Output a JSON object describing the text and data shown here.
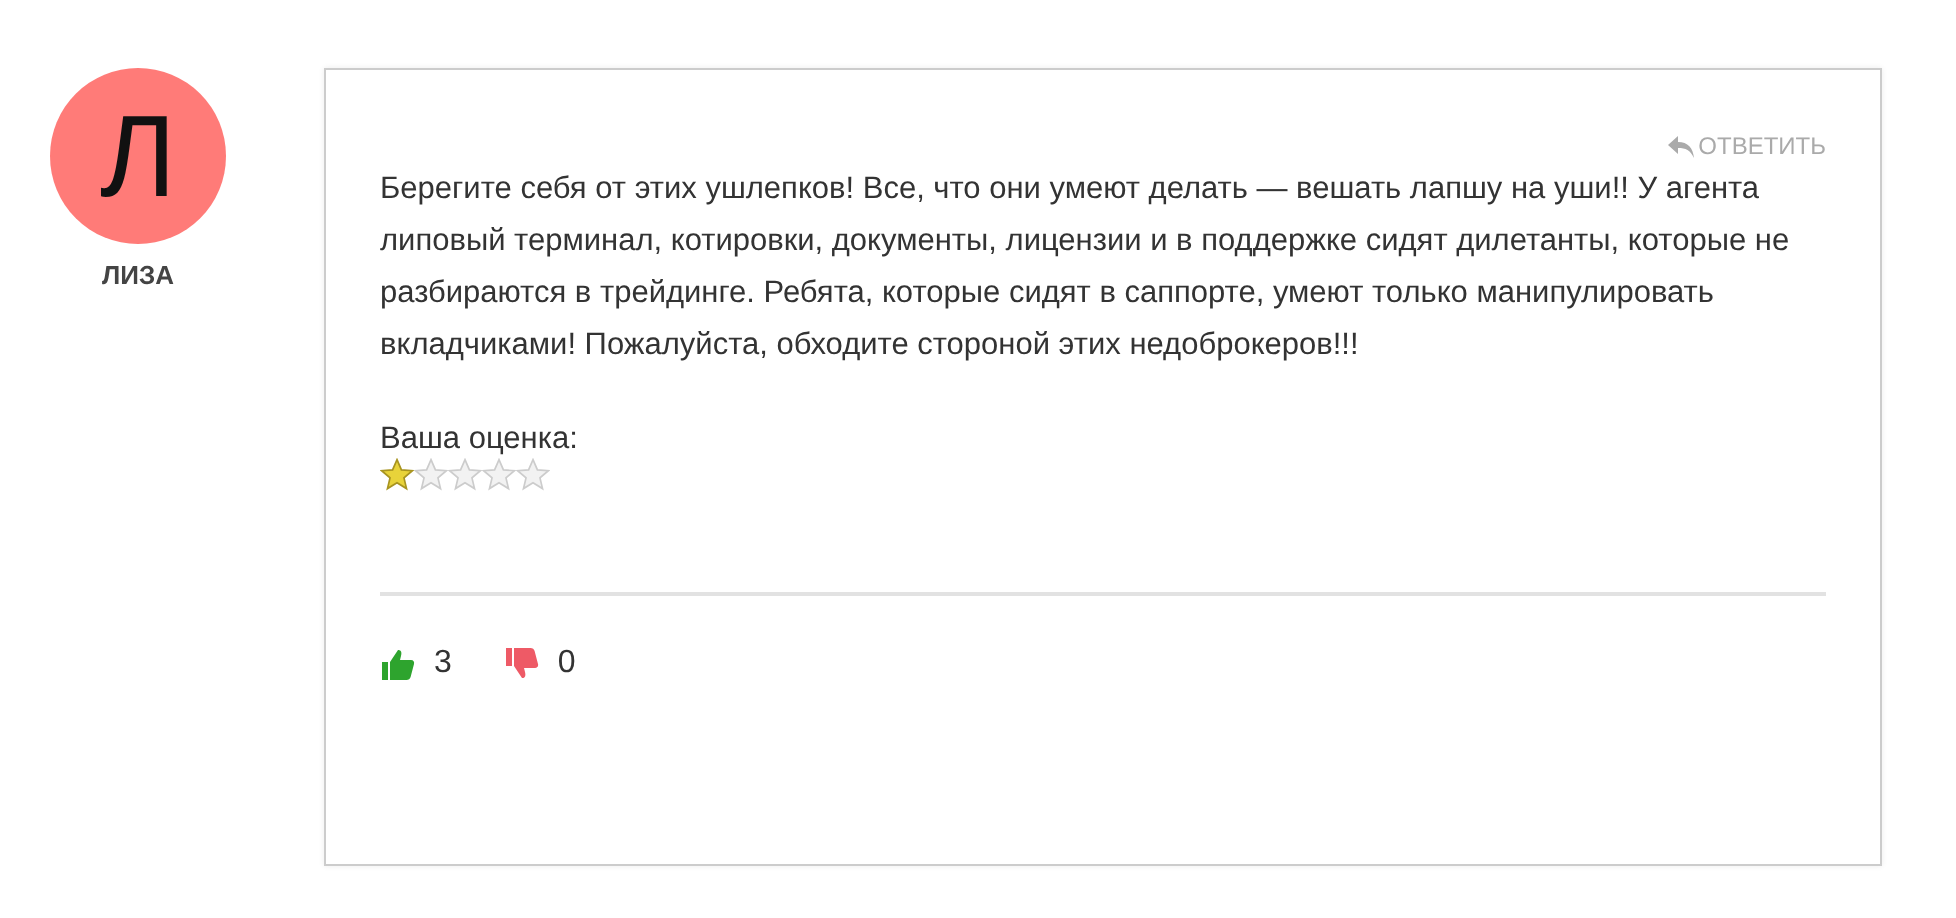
{
  "author": {
    "initial": "Л",
    "name": "ЛИЗА",
    "color": "#ff7b78"
  },
  "reply": "ОТВЕТИТЬ",
  "text": "Берегите себя от этих ушлепков! Все, что они умеют делать — вешать лапшу на уши!! У агента липовый терминал, котировки, документы, лицензии и в поддержке сидят дилетанты, которые не разбираются в трейдинге. Ребята, которые сидят в саппорте, умеют только манипулировать вкладчиками! Пожалуйста, обходите стороной этих недоброкеров!!!",
  "rating": {
    "label": "Ваша оценка:",
    "stars": 1
  },
  "likes": "3",
  "dislikes": "0"
}
